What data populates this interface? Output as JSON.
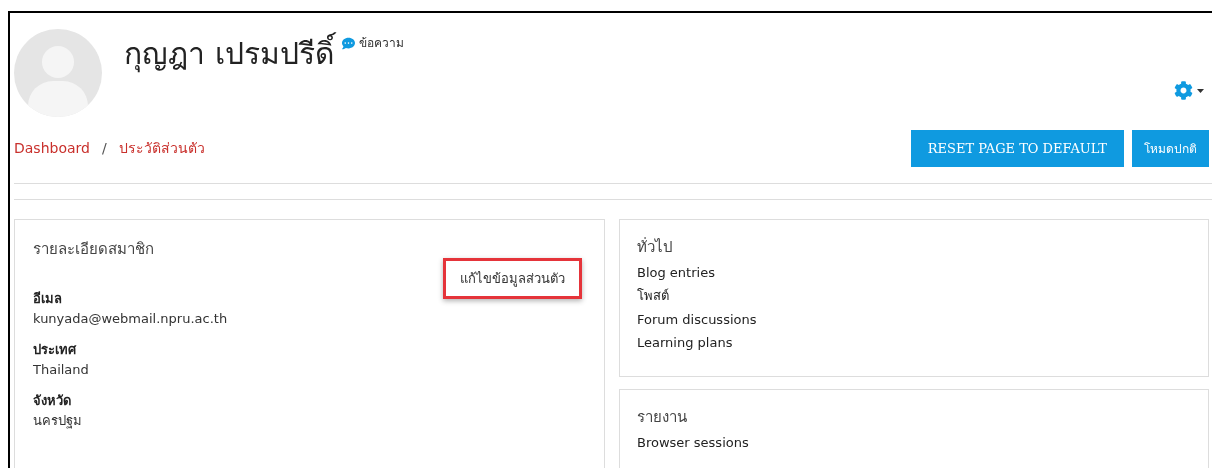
{
  "header": {
    "name": "กุญฎา เปรมปรีดิ์",
    "message_link": "ข้อความ"
  },
  "breadcrumb": [
    "Dashboard",
    "ประวัติส่วนตัว"
  ],
  "breadcrumb_separator": "/",
  "buttons": [
    "RESET PAGE TO DEFAULT",
    "โหมดปกติ"
  ],
  "member_card": {
    "title": "รายละเอียดสมาชิก",
    "edit_link": {
      "label": "แก้ไขข้อมูลส่วนตัว",
      "highlighted": true
    },
    "fields": [
      {
        "label": "อีเมล",
        "value": "kunyada@webmail.npru.ac.th"
      },
      {
        "label": "ประเทศ",
        "value": "Thailand"
      },
      {
        "label": "จังหวัด",
        "value": "นครปฐม"
      }
    ]
  },
  "sections": [
    {
      "title": "ทั่วไป",
      "links": [
        "Blog entries",
        "โพสต์",
        "Forum discussions",
        "Learning plans"
      ]
    },
    {
      "title": "รายงาน",
      "links": [
        "Browser sessions"
      ]
    }
  ]
}
